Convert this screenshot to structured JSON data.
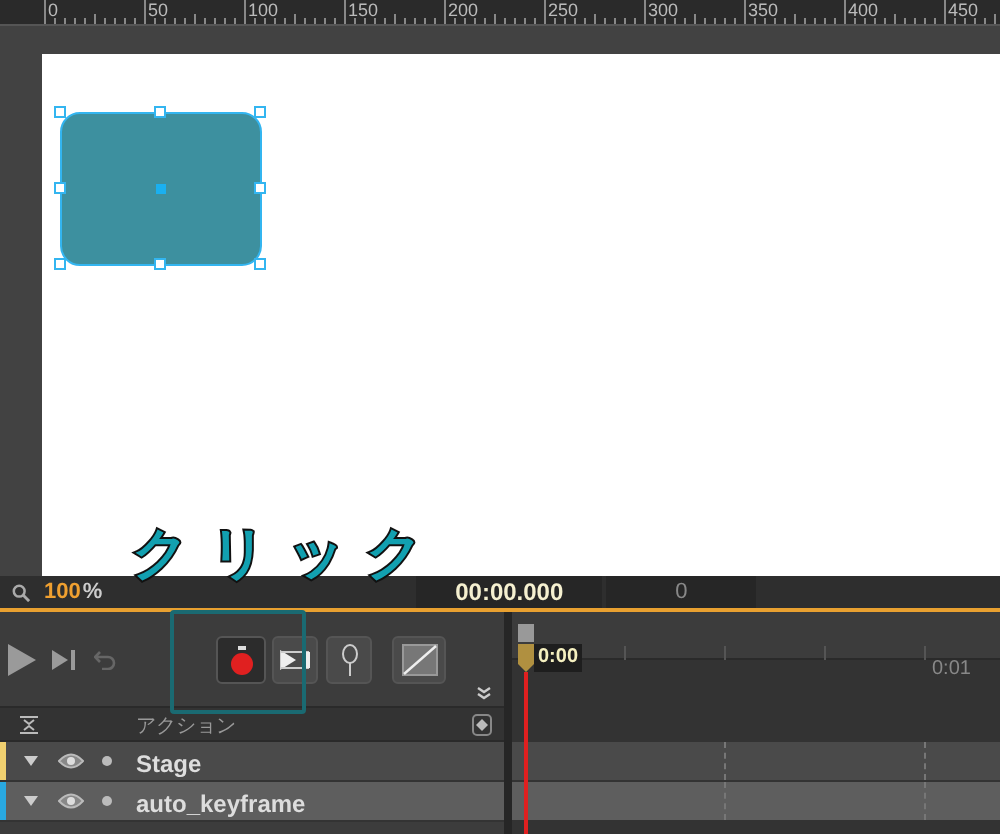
{
  "ruler": {
    "labels": [
      "0",
      "50",
      "100",
      "150",
      "200",
      "250",
      "300",
      "350",
      "400",
      "450"
    ]
  },
  "stage": {
    "shape": {
      "selected": true
    }
  },
  "annotation": {
    "text": "クリック"
  },
  "status_bar": {
    "zoom": "100",
    "zoom_unit": "%",
    "timecode": "00:00.000",
    "frame": "0"
  },
  "timeline": {
    "playhead": "0:00",
    "end_label": "0:01"
  },
  "layers": {
    "header": "アクション",
    "rows": [
      {
        "name": "Stage",
        "color": "#f0d070",
        "selected": false
      },
      {
        "name": "auto_keyframe",
        "color": "#29a8e0",
        "selected": true
      }
    ]
  }
}
